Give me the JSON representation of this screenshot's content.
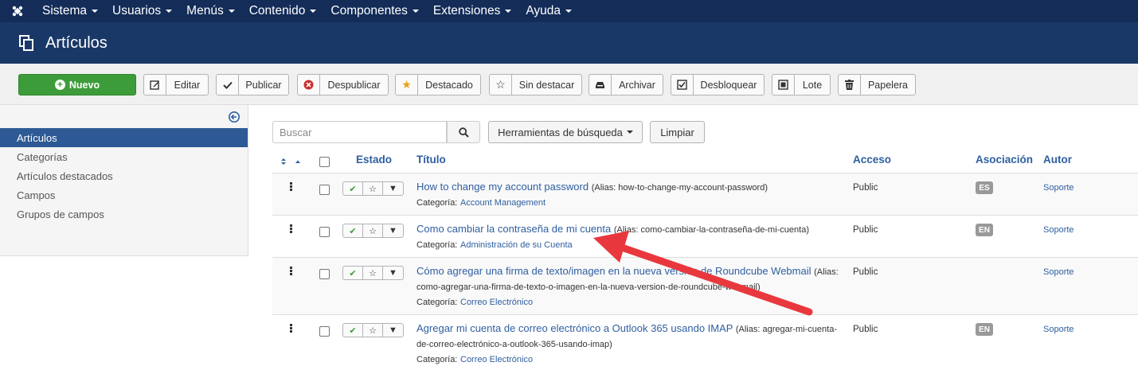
{
  "navbar": {
    "items": [
      "Sistema",
      "Usuarios",
      "Menús",
      "Contenido",
      "Componentes",
      "Extensiones",
      "Ayuda"
    ]
  },
  "header": {
    "title": "Artículos"
  },
  "toolbar": {
    "new_label": "Nuevo",
    "edit_label": "Editar",
    "publish_label": "Publicar",
    "unpublish_label": "Despublicar",
    "feature_label": "Destacado",
    "unfeature_label": "Sin destacar",
    "archive_label": "Archivar",
    "checkin_label": "Desbloquear",
    "batch_label": "Lote",
    "trash_label": "Papelera"
  },
  "sidebar": {
    "items": [
      "Artículos",
      "Categorías",
      "Artículos destacados",
      "Campos",
      "Grupos de campos"
    ],
    "active_index": 0
  },
  "search": {
    "placeholder": "Buscar",
    "tools_label": "Herramientas de búsqueda",
    "clear_label": "Limpiar"
  },
  "table": {
    "headers": {
      "state": "Estado",
      "title": "Título",
      "access": "Acceso",
      "association": "Asociación",
      "author": "Autor"
    },
    "category_prefix": "Categoría:",
    "rows": [
      {
        "title": "How to change my account password",
        "alias": "(Alias: how-to-change-my-account-password)",
        "category": "Account Management",
        "access": "Public",
        "association": "ES",
        "author": "Soporte"
      },
      {
        "title": "Como cambiar la contraseña de mi cuenta",
        "alias": "(Alias: como-cambiar-la-contraseña-de-mi-cuenta)",
        "category": "Administración de su Cuenta",
        "access": "Public",
        "association": "EN",
        "author": "Soporte"
      },
      {
        "title": "Cómo agregar una firma de texto/imagen en la nueva versión de Roundcube Webmail",
        "alias": "(Alias: como-agregar-una-firma-de-texto-o-imagen-en-la-nueva-version-de-roundcube-webmail)",
        "category": "Correo Electrónico",
        "access": "Public",
        "association": "",
        "author": "Soporte"
      },
      {
        "title": "Agregar mi cuenta de correo electrónico a Outlook 365 usando IMAP",
        "alias": "(Alias: agregar-mi-cuenta-de-correo-electrónico-a-outlook-365-usando-imap)",
        "category": "Correo Electrónico",
        "access": "Public",
        "association": "EN",
        "author": "Soporte"
      }
    ]
  },
  "colors": {
    "navbar": "#132c58",
    "header": "#1a3867",
    "new_button": "#3d9c3a",
    "link": "#2f5fa0",
    "sidebar_active": "#2d5a94",
    "annotation_arrow": "#e8383d"
  }
}
